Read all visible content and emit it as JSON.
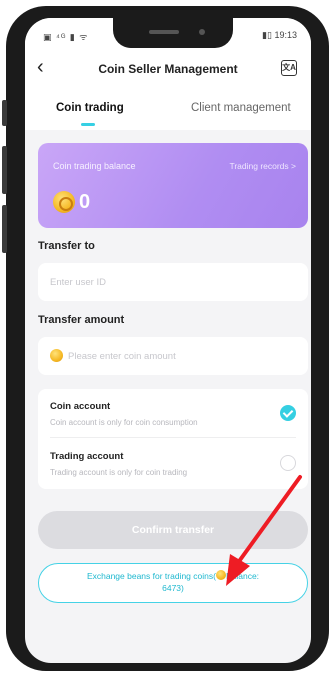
{
  "status": {
    "left": "▣ ⁴ᴳ ▮ ᯤ",
    "right": "▮▯ 19:13"
  },
  "header": {
    "back": "‹",
    "title": "Coin Seller Management",
    "translate_icon": "translate-icon"
  },
  "tabs": [
    {
      "label": "Coin trading",
      "active": true
    },
    {
      "label": "Client management",
      "active": false
    }
  ],
  "balance_card": {
    "label": "Coin trading balance",
    "link": "Trading records >",
    "value": "0"
  },
  "transfer_to": {
    "label": "Transfer to",
    "placeholder": "Enter user ID"
  },
  "transfer_amount": {
    "label": "Transfer amount",
    "placeholder": "Please enter coin amount"
  },
  "accounts": [
    {
      "title": "Coin account",
      "subtitle": "Coin account is only for coin consumption",
      "selected": true
    },
    {
      "title": "Trading account",
      "subtitle": "Trading account is only for coin trading",
      "selected": false
    }
  ],
  "confirm_label": "Confirm transfer",
  "exchange": {
    "prefix": "Exchange beans for trading coins(",
    "balance_label": "Balance:",
    "balance_value": "6473)"
  },
  "colors": {
    "accent": "#36d0e4",
    "card_start": "#c9a6f7",
    "card_end": "#a883ee",
    "annotation_arrow": "#ee1c24"
  }
}
